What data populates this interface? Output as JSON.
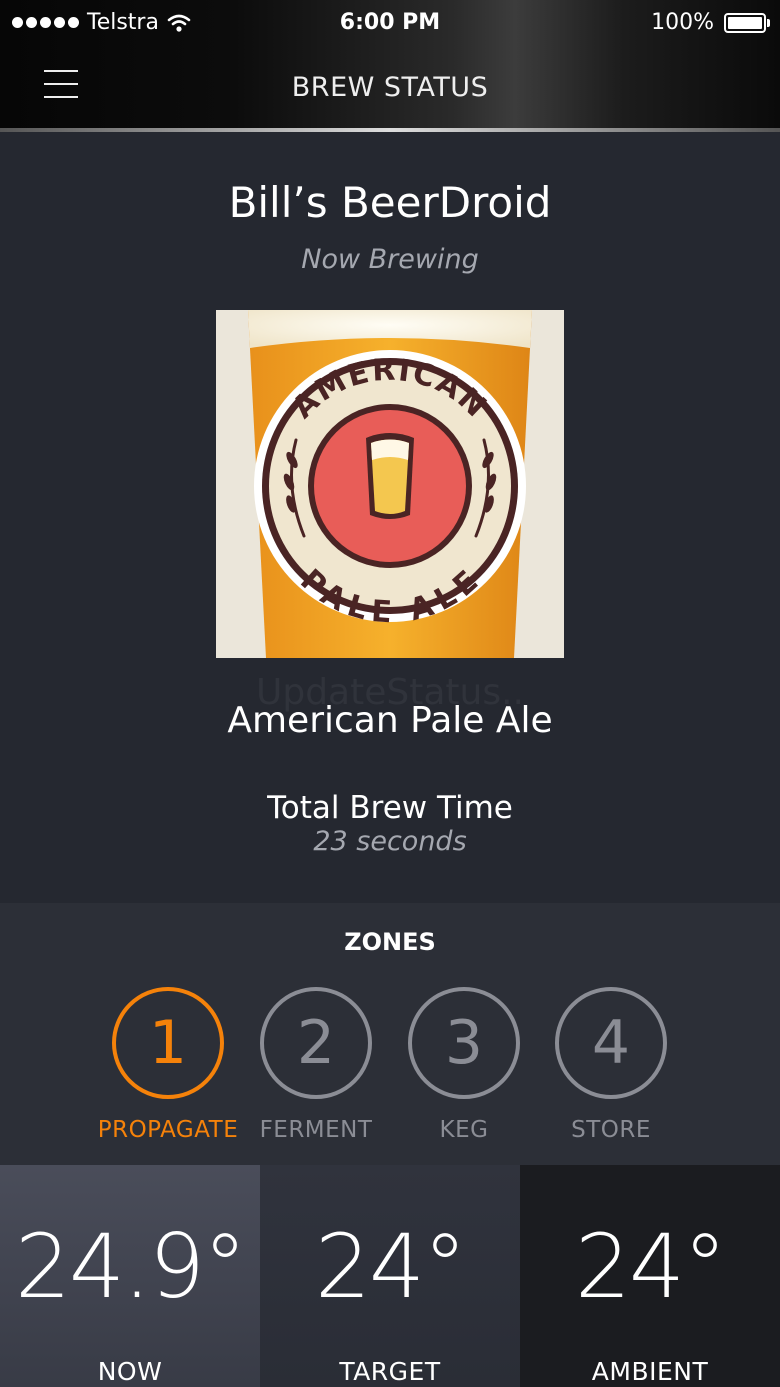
{
  "status_bar": {
    "carrier": "Telstra",
    "time": "6:00 PM",
    "battery": "100%",
    "signal_icon": "signal-dots-icon",
    "wifi_icon": "wifi-icon",
    "battery_icon": "battery-icon"
  },
  "header": {
    "title": "BREW STATUS",
    "menu_icon": "hamburger-menu-icon"
  },
  "brew": {
    "device_name": "Bill’s BeerDroid",
    "subtitle": "Now Brewing",
    "watermark_text": "UpdateStatus..",
    "beer_name": "American Pale Ale",
    "brew_time_label": "Total Brew Time",
    "brew_time_value": "23 seconds",
    "image": {
      "badge_top": "AMERICAN",
      "badge_bottom": "PALE ALE"
    }
  },
  "zones": {
    "title": "ZONES",
    "items": [
      {
        "number": "1",
        "label": "PROPAGATE",
        "active": true
      },
      {
        "number": "2",
        "label": "FERMENT",
        "active": false
      },
      {
        "number": "3",
        "label": "KEG",
        "active": false
      },
      {
        "number": "4",
        "label": "STORE",
        "active": false
      }
    ]
  },
  "temperatures": [
    {
      "value": "24.9°",
      "label": "NOW"
    },
    {
      "value": "24°",
      "label": "TARGET"
    },
    {
      "value": "24°",
      "label": "AMBIENT"
    }
  ],
  "colors": {
    "accent": "#f5820a",
    "inactive": "#8b8d95",
    "background": "#252830"
  }
}
